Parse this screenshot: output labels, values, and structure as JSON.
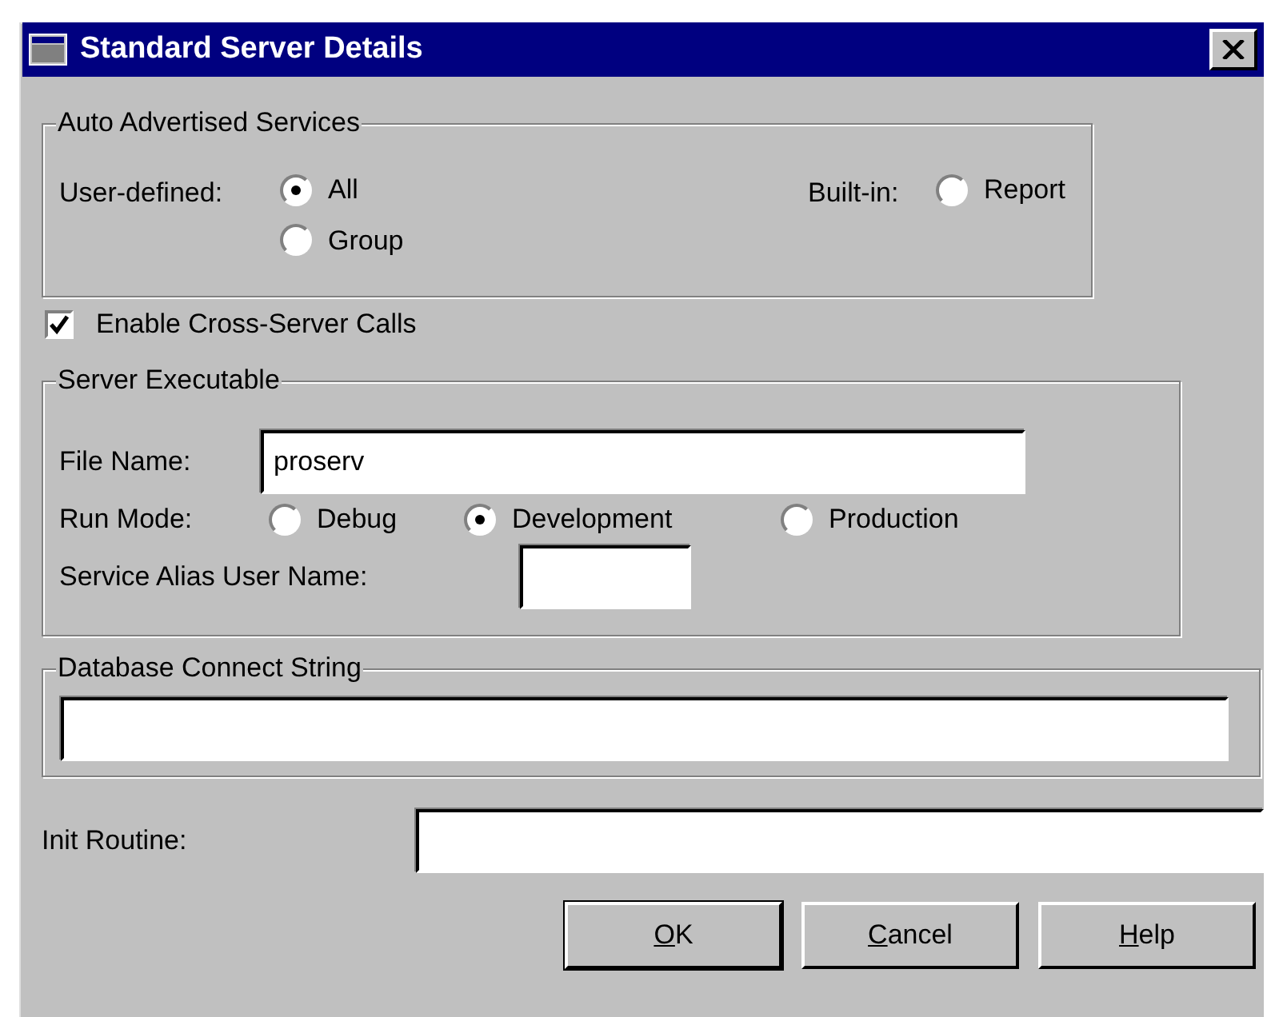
{
  "window": {
    "title": "Standard Server Details"
  },
  "auto_advertised": {
    "legend": "Auto Advertised Services",
    "user_defined_label": "User-defined:",
    "user_defined_options": [
      {
        "label": "All",
        "selected": true
      },
      {
        "label": "Group",
        "selected": false
      }
    ],
    "built_in_label": "Built-in:",
    "built_in_options": [
      {
        "label": "Report",
        "selected": false
      }
    ]
  },
  "cross_server": {
    "label": "Enable Cross-Server Calls",
    "checked": true
  },
  "server_executable": {
    "legend": "Server Executable",
    "file_name_label": "File Name:",
    "file_name_value": "proserv",
    "run_mode_label": "Run Mode:",
    "run_mode_options": [
      {
        "label": "Debug",
        "selected": false
      },
      {
        "label": "Development",
        "selected": true
      },
      {
        "label": "Production",
        "selected": false
      }
    ],
    "alias_label": "Service Alias User Name:"
  },
  "database": {
    "legend": "Database Connect String"
  },
  "init_routine": {
    "label": "Init Routine:"
  },
  "buttons": [
    {
      "label": "OK",
      "default": true,
      "mnemonic": true
    },
    {
      "label": "Cancel",
      "default": false,
      "mnemonic": true
    },
    {
      "label": "Help",
      "default": false,
      "mnemonic": true
    }
  ]
}
